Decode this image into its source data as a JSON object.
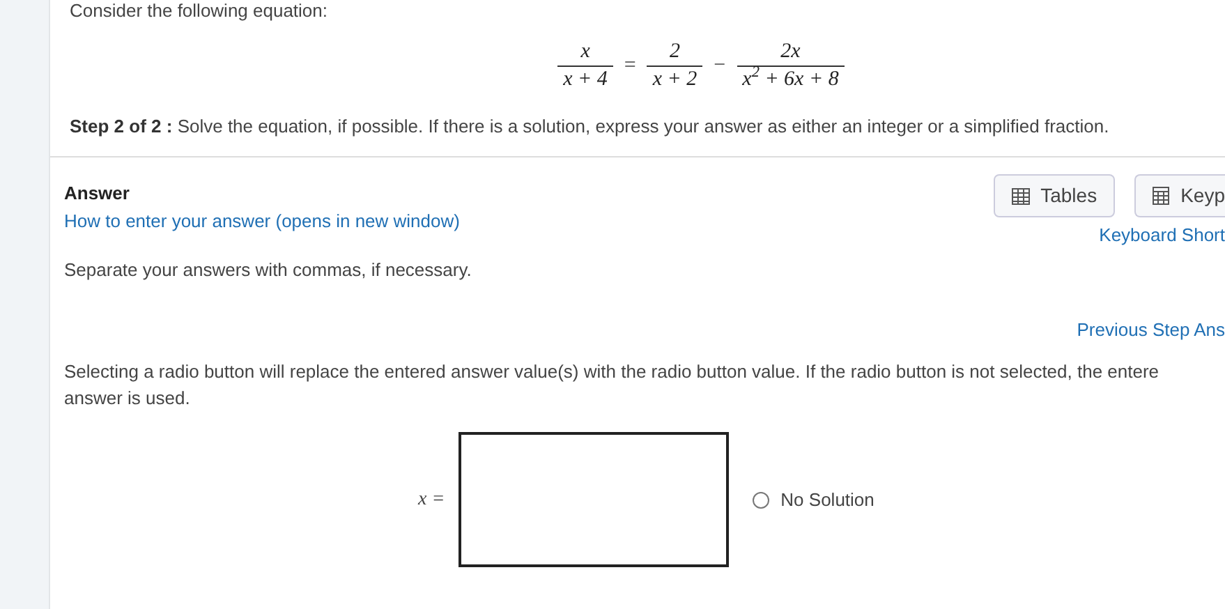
{
  "intro": "Consider the following equation:",
  "equation": {
    "fractions": [
      {
        "numerator": "x",
        "denominator": "x + 4"
      },
      {
        "numerator": "2",
        "denominator": "x + 2"
      },
      {
        "numerator": "2x",
        "denominator": "x$^{2}$ + 6x + 8"
      }
    ],
    "operators": [
      "=",
      "−"
    ]
  },
  "step": {
    "label": "Step 2 of 2 :",
    "text": "Solve the equation, if possible. If there is a solution, express your answer as either an integer or a simplified fraction."
  },
  "answer": {
    "heading": "Answer",
    "help_link": "How to enter your answer (opens in new window)",
    "note": "Separate your answers with commas, if necessary."
  },
  "tools": [
    {
      "kind": "table",
      "label": "Tables"
    },
    {
      "kind": "keypad",
      "label": "Keyp"
    }
  ],
  "shortcuts_link": "Keyboard Short",
  "previous_link": "Previous Step Ans",
  "radio_note": [
    "Selecting a radio button will replace the entered answer value(s) with the radio button value. If the radio button is not selected, the entere",
    "answer is used."
  ],
  "input": {
    "label": "x ="
  },
  "options": [
    {
      "label": "No Solution",
      "selected": false
    }
  ]
}
